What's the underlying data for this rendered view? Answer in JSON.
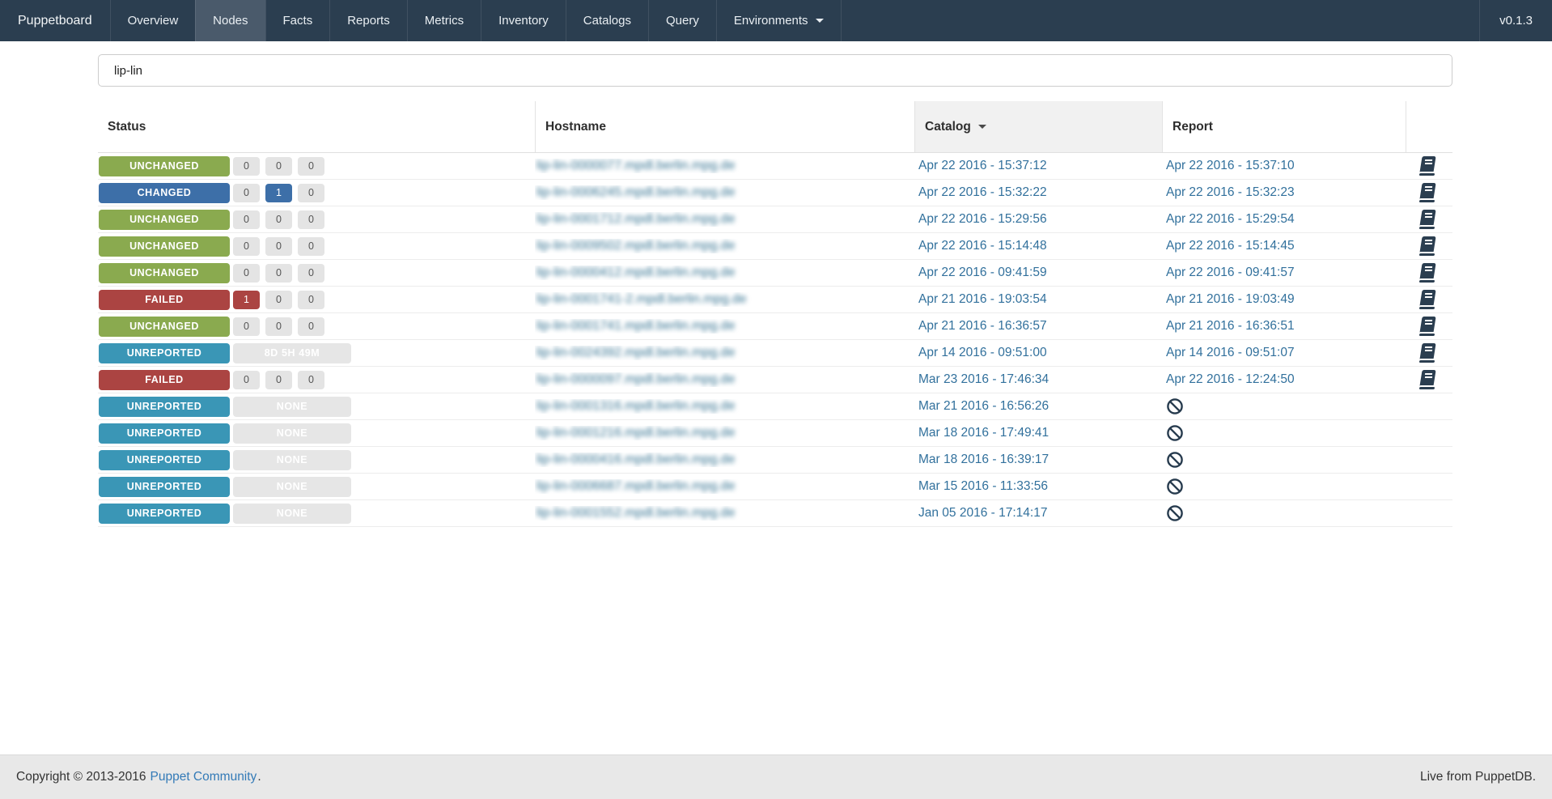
{
  "navbar": {
    "brand": "Puppetboard",
    "items": [
      "Overview",
      "Nodes",
      "Facts",
      "Reports",
      "Metrics",
      "Inventory",
      "Catalogs",
      "Query",
      "Environments"
    ],
    "active_item": "Nodes",
    "dropdown_item": "Environments",
    "version": "v0.1.3"
  },
  "search": {
    "value": "lip-lin"
  },
  "table": {
    "columns": [
      "Status",
      "Hostname",
      "Catalog",
      "Report"
    ],
    "sorted_column": "Catalog",
    "sort_direction": "desc",
    "rows": [
      {
        "status": "UNCHANGED",
        "status_color": "green",
        "counts": [
          {
            "value": "0",
            "style": "default"
          },
          {
            "value": "0",
            "style": "default"
          },
          {
            "value": "0",
            "style": "default"
          }
        ],
        "hostname": "lip-lin-0000077.mpdl.berlin.mpg.de",
        "catalog": "Apr 22 2016 - 15:37:12",
        "report": "Apr 22 2016 - 15:37:10",
        "report_icon": "book"
      },
      {
        "status": "CHANGED",
        "status_color": "blue",
        "counts": [
          {
            "value": "0",
            "style": "default"
          },
          {
            "value": "1",
            "style": "blue"
          },
          {
            "value": "0",
            "style": "default"
          }
        ],
        "hostname": "lip-lin-0006245.mpdl.berlin.mpg.de",
        "catalog": "Apr 22 2016 - 15:32:22",
        "report": "Apr 22 2016 - 15:32:23",
        "report_icon": "book"
      },
      {
        "status": "UNCHANGED",
        "status_color": "green",
        "counts": [
          {
            "value": "0",
            "style": "default"
          },
          {
            "value": "0",
            "style": "default"
          },
          {
            "value": "0",
            "style": "default"
          }
        ],
        "hostname": "lip-lin-0001712.mpdl.berlin.mpg.de",
        "catalog": "Apr 22 2016 - 15:29:56",
        "report": "Apr 22 2016 - 15:29:54",
        "report_icon": "book"
      },
      {
        "status": "UNCHANGED",
        "status_color": "green",
        "counts": [
          {
            "value": "0",
            "style": "default"
          },
          {
            "value": "0",
            "style": "default"
          },
          {
            "value": "0",
            "style": "default"
          }
        ],
        "hostname": "lip-lin-0009502.mpdl.berlin.mpg.de",
        "catalog": "Apr 22 2016 - 15:14:48",
        "report": "Apr 22 2016 - 15:14:45",
        "report_icon": "book"
      },
      {
        "status": "UNCHANGED",
        "status_color": "green",
        "counts": [
          {
            "value": "0",
            "style": "default"
          },
          {
            "value": "0",
            "style": "default"
          },
          {
            "value": "0",
            "style": "default"
          }
        ],
        "hostname": "lip-lin-0000412.mpdl.berlin.mpg.de",
        "catalog": "Apr 22 2016 - 09:41:59",
        "report": "Apr 22 2016 - 09:41:57",
        "report_icon": "book"
      },
      {
        "status": "FAILED",
        "status_color": "red",
        "counts": [
          {
            "value": "1",
            "style": "red"
          },
          {
            "value": "0",
            "style": "default"
          },
          {
            "value": "0",
            "style": "default"
          }
        ],
        "hostname": "lip-lin-0001741-2.mpdl.berlin.mpg.de",
        "catalog": "Apr 21 2016 - 19:03:54",
        "report": "Apr 21 2016 - 19:03:49",
        "report_icon": "book"
      },
      {
        "status": "UNCHANGED",
        "status_color": "green",
        "counts": [
          {
            "value": "0",
            "style": "default"
          },
          {
            "value": "0",
            "style": "default"
          },
          {
            "value": "0",
            "style": "default"
          }
        ],
        "hostname": "lip-lin-0001741.mpdl.berlin.mpg.de",
        "catalog": "Apr 21 2016 - 16:36:57",
        "report": "Apr 21 2016 - 16:36:51",
        "report_icon": "book"
      },
      {
        "status": "UNREPORTED",
        "status_color": "teal",
        "duration": "8D 5H 49M",
        "hostname": "lip-lin-0024392.mpdl.berlin.mpg.de",
        "catalog": "Apr 14 2016 - 09:51:00",
        "report": "Apr 14 2016 - 09:51:07",
        "report_icon": "book"
      },
      {
        "status": "FAILED",
        "status_color": "red",
        "counts": [
          {
            "value": "0",
            "style": "default"
          },
          {
            "value": "0",
            "style": "default"
          },
          {
            "value": "0",
            "style": "default"
          }
        ],
        "hostname": "lip-lin-0000097.mpdl.berlin.mpg.de",
        "catalog": "Mar 23 2016 - 17:46:34",
        "report": "Apr 22 2016 - 12:24:50",
        "report_icon": "book"
      },
      {
        "status": "UNREPORTED",
        "status_color": "teal",
        "duration": "NONE",
        "hostname": "lip-lin-0001316.mpdl.berlin.mpg.de",
        "catalog": "Mar 21 2016 - 16:56:26",
        "report": "",
        "report_icon": "ban"
      },
      {
        "status": "UNREPORTED",
        "status_color": "teal",
        "duration": "NONE",
        "hostname": "lip-lin-0001216.mpdl.berlin.mpg.de",
        "catalog": "Mar 18 2016 - 17:49:41",
        "report": "",
        "report_icon": "ban"
      },
      {
        "status": "UNREPORTED",
        "status_color": "teal",
        "duration": "NONE",
        "hostname": "lip-lin-0000416.mpdl.berlin.mpg.de",
        "catalog": "Mar 18 2016 - 16:39:17",
        "report": "",
        "report_icon": "ban"
      },
      {
        "status": "UNREPORTED",
        "status_color": "teal",
        "duration": "NONE",
        "hostname": "lip-lin-0006687.mpdl.berlin.mpg.de",
        "catalog": "Mar 15 2016 - 11:33:56",
        "report": "",
        "report_icon": "ban"
      },
      {
        "status": "UNREPORTED",
        "status_color": "teal",
        "duration": "NONE",
        "hostname": "lip-lin-0001552.mpdl.berlin.mpg.de",
        "catalog": "Jan 05 2016 - 17:14:17",
        "report": "",
        "report_icon": "ban"
      }
    ]
  },
  "footer": {
    "copyright_prefix": "Copyright © 2013-2016",
    "community_link": "Puppet Community",
    "copyright_suffix": ".",
    "right_text": "Live from PuppetDB."
  },
  "colors": {
    "navbar_bg": "#2b3e50",
    "navbar_active_bg": "#4a5a6b",
    "status_unchanged": "#8aaa4f",
    "status_changed": "#3d6fa8",
    "status_failed": "#ab4442",
    "status_unreported": "#3a96b6",
    "count_pill_bg": "#e4e4e4",
    "table_link": "#31709c",
    "footer_bg": "#e8e8e8",
    "footer_link": "#337ab7",
    "sorted_header_bg": "#f1f1f1"
  }
}
